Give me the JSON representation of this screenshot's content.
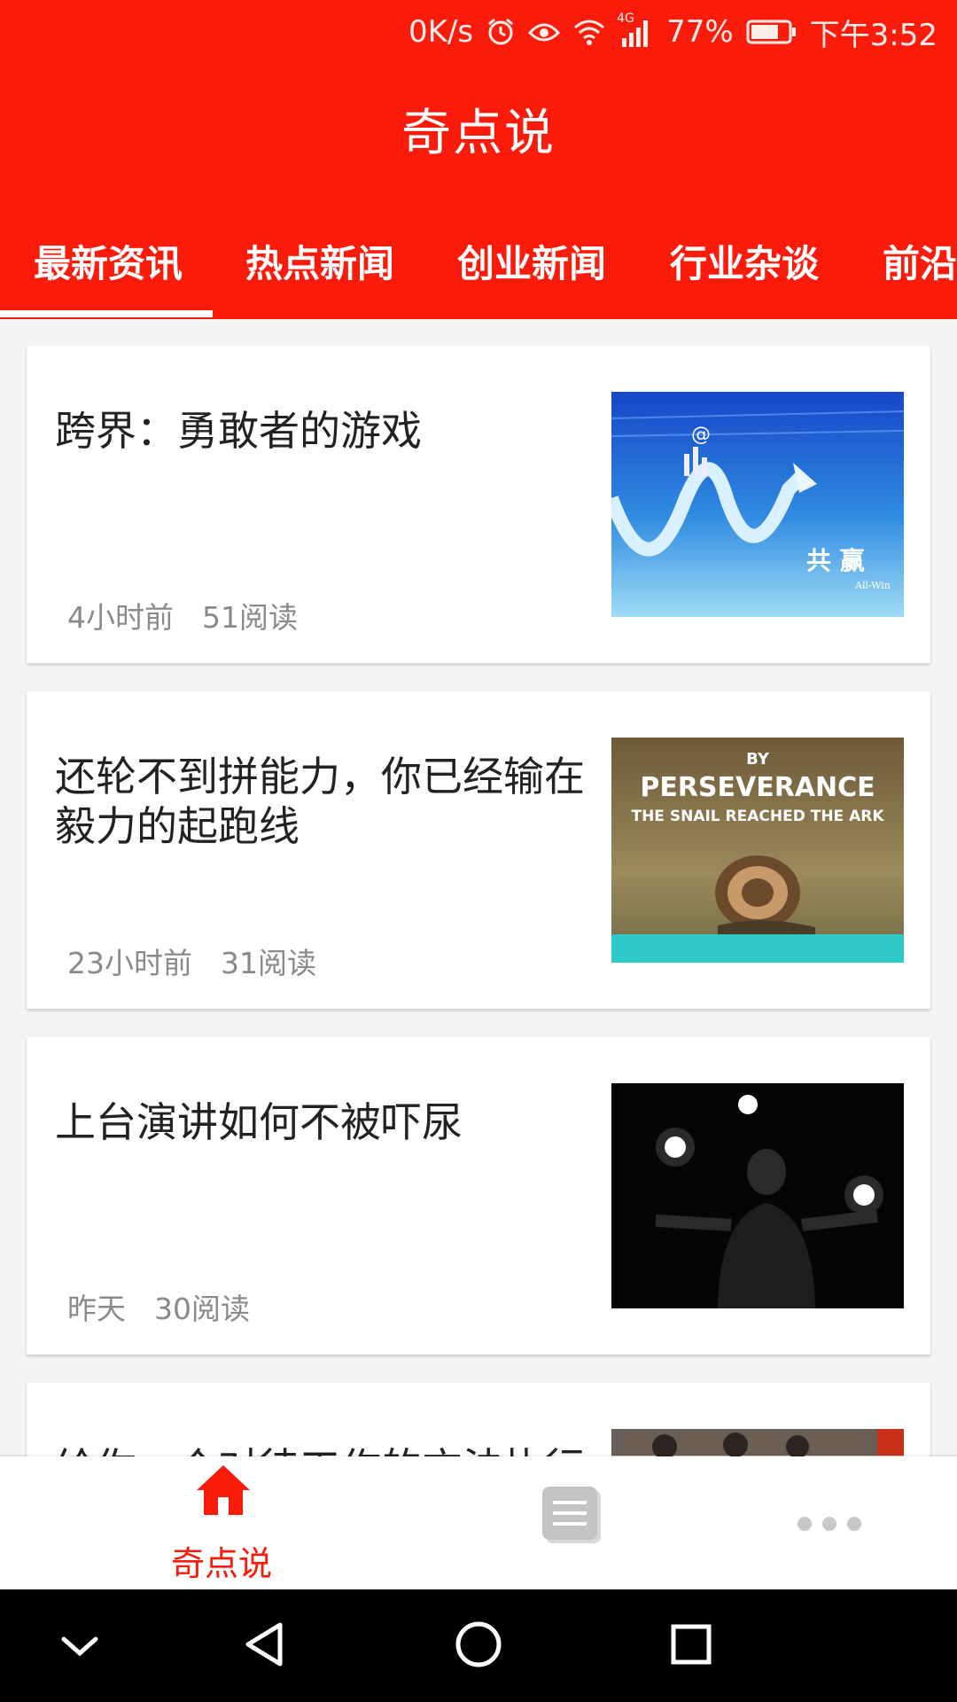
{
  "status_bar": {
    "net_speed": "0K/s",
    "network": "4G",
    "battery": "77%",
    "time": "下午3:52",
    "icons": [
      "alarm-icon",
      "eye-icon",
      "wifi-icon",
      "signal-icon",
      "battery-icon"
    ]
  },
  "app": {
    "title": "奇点说",
    "accent_color": "#fb1b0a"
  },
  "tabs": {
    "items": [
      {
        "label": "最新资讯",
        "selected": true
      },
      {
        "label": "热点新闻",
        "selected": false
      },
      {
        "label": "创业新闻",
        "selected": false
      },
      {
        "label": "行业杂谈",
        "selected": false
      },
      {
        "label": "前沿",
        "selected": false
      }
    ]
  },
  "articles": [
    {
      "title": "跨界：勇敢者的游戏",
      "time": "4小时前",
      "reads": "51阅读",
      "thumb": {
        "type": "all-win",
        "label_big": "共 赢",
        "label_small": "All-Win"
      }
    },
    {
      "title": "还轮不到拼能力，你已经输在毅力的起跑线",
      "time": "23小时前",
      "reads": "31阅读",
      "thumb": {
        "type": "snail",
        "line1": "BY",
        "line2": "PERSEVERANCE",
        "line3": "THE SNAIL REACHED THE ARK"
      }
    },
    {
      "title": "上台演讲如何不被吓尿",
      "time": "昨天",
      "reads": "30阅读",
      "thumb": {
        "type": "speaker"
      }
    },
    {
      "title": "给你一个对待工作的方法执行",
      "time": "",
      "reads": "",
      "thumb": {
        "type": "office"
      }
    }
  ],
  "bottom_nav": {
    "items": [
      {
        "label": "奇点说",
        "icon": "home-icon",
        "active": true
      },
      {
        "label": "",
        "icon": "news-icon",
        "active": false
      },
      {
        "label": "",
        "icon": "more-icon",
        "active": false
      }
    ]
  },
  "system_nav": {
    "icons": [
      "chevron-down-icon",
      "back-icon",
      "home-circle-icon",
      "recents-icon"
    ]
  }
}
